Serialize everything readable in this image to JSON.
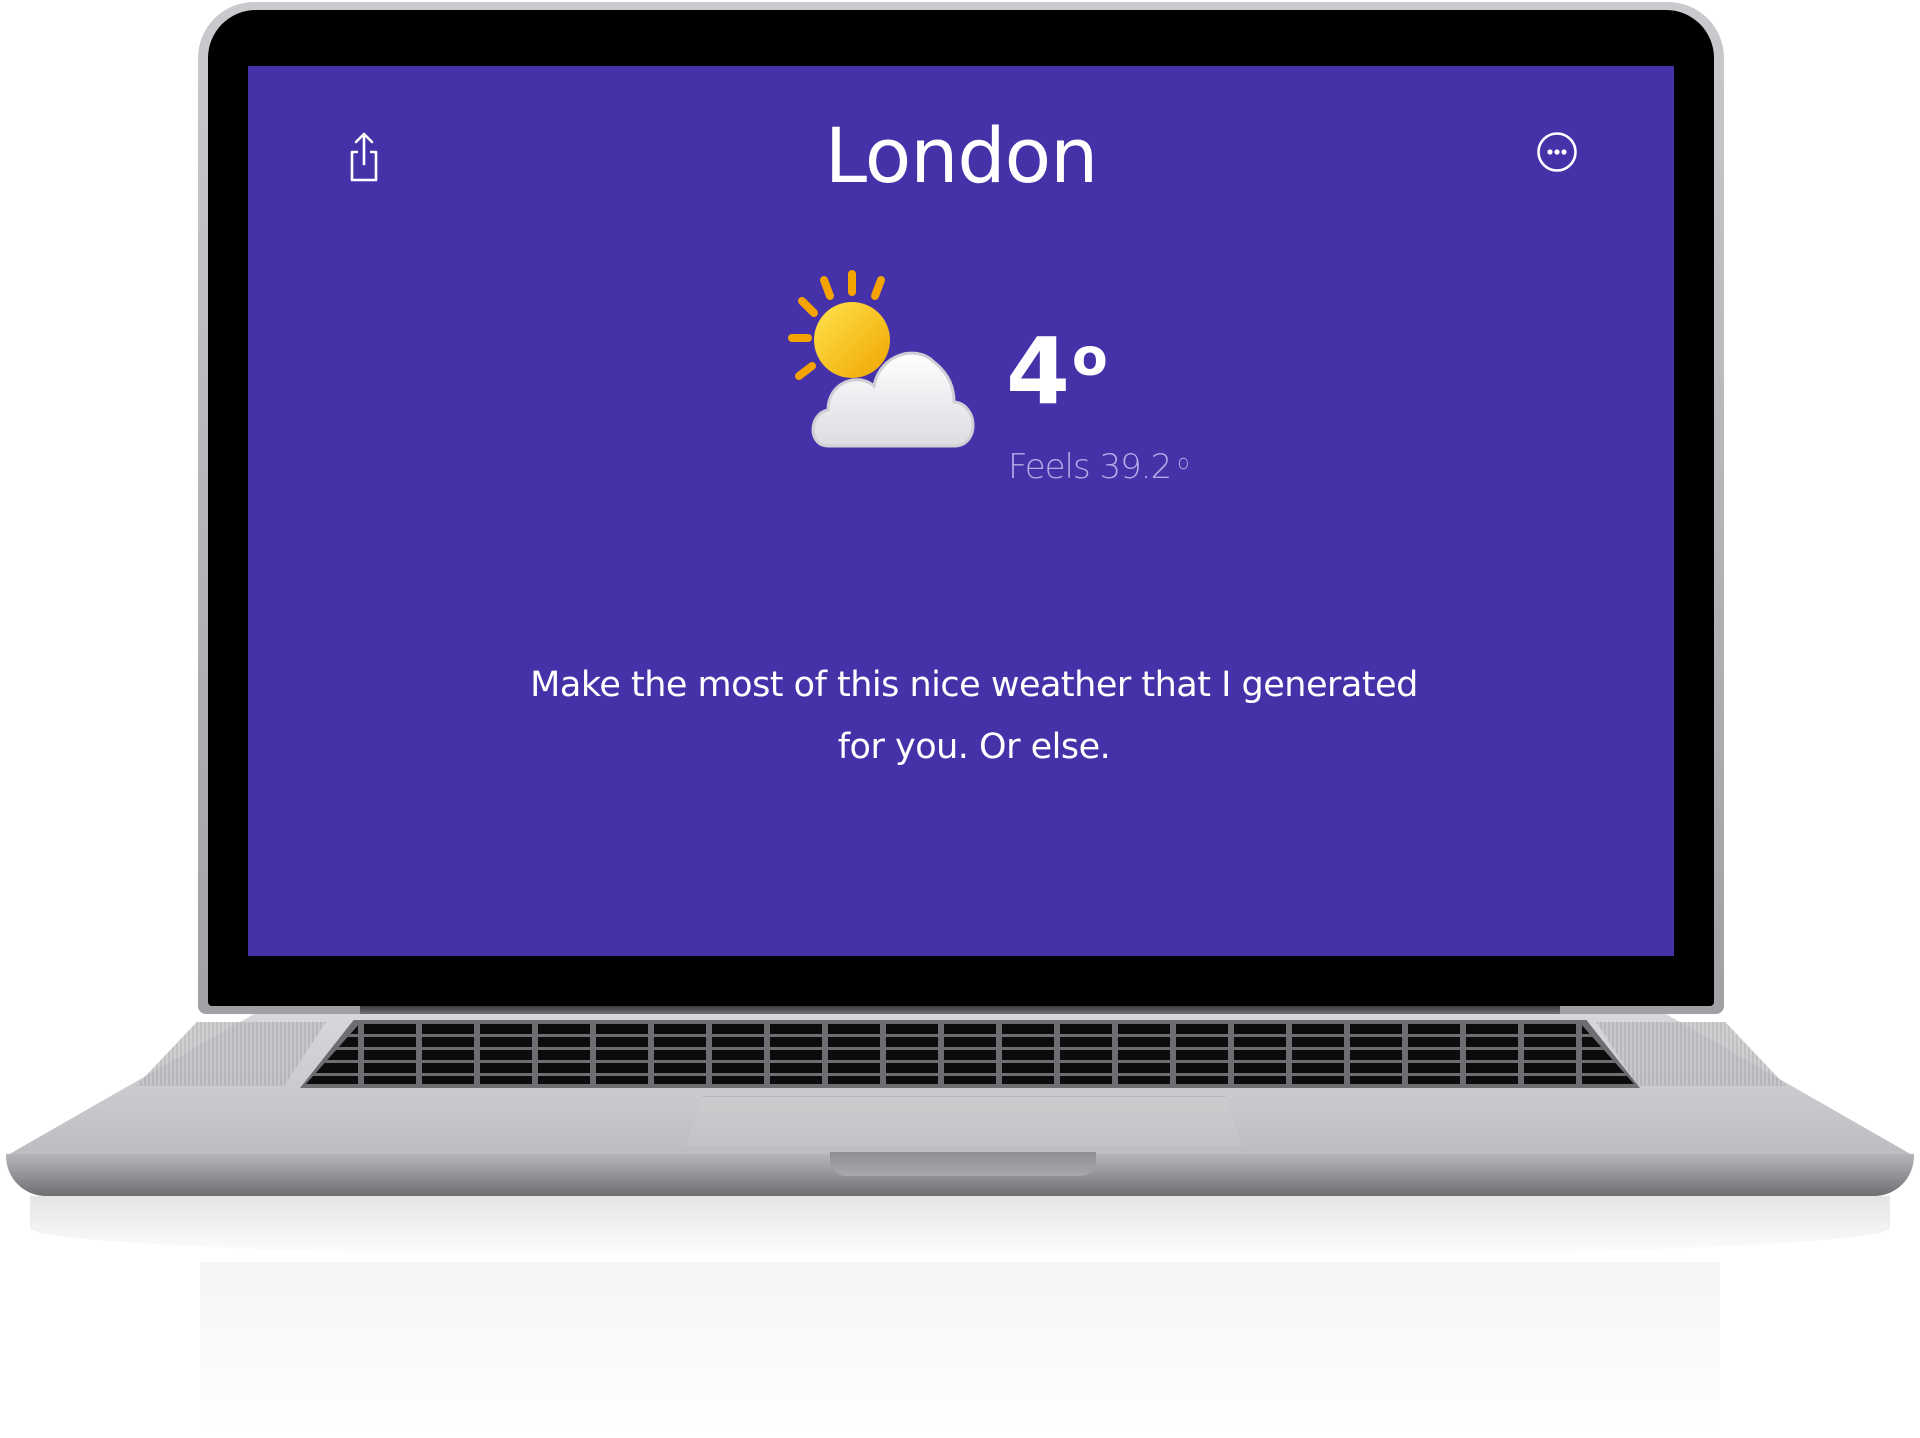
{
  "app": {
    "city": "London",
    "temperature": "4",
    "temperature_unit": "o",
    "feels_like": "Feels 39.2",
    "feels_unit": "o",
    "message": "Make the most of this nice weather that I generated for you. Or else.",
    "condition_icon": "partly-cloudy-icon"
  },
  "toolbar": {
    "share_icon": "share-icon",
    "more_icon": "more-options-icon"
  },
  "colors": {
    "screen_background": "#4632a8",
    "text_primary": "#ffffff",
    "text_secondary": "#b6abe6",
    "sun": "#f5b400",
    "sun_rays": "#f5a300",
    "cloud": "#f4f4f6"
  }
}
